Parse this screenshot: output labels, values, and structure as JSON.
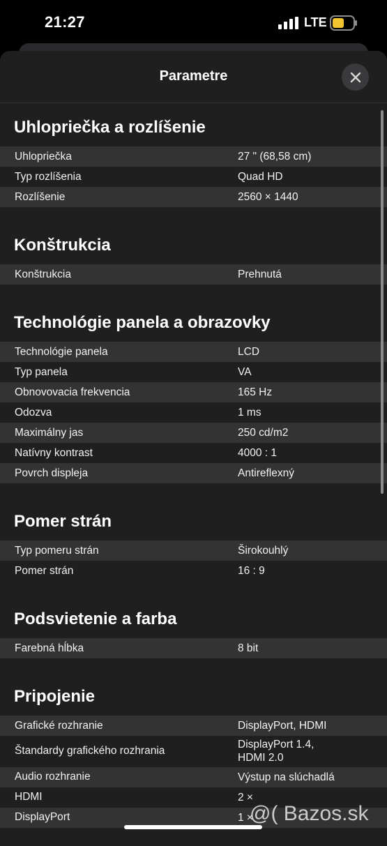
{
  "status_bar": {
    "time": "21:27",
    "network": "LTE"
  },
  "sheet": {
    "title": "Parametre"
  },
  "sections": [
    {
      "title": "Uhlopriečka a rozlíšenie",
      "rows": [
        {
          "label": "Uhlopriečka",
          "value": "27 \" (68,58 cm)"
        },
        {
          "label": "Typ rozlíšenia",
          "value": "Quad HD"
        },
        {
          "label": "Rozlíšenie",
          "value": "2560 × 1440"
        }
      ]
    },
    {
      "title": "Konštrukcia",
      "rows": [
        {
          "label": "Konštrukcia",
          "value": "Prehnutá"
        }
      ]
    },
    {
      "title": "Technológie panela a obrazovky",
      "rows": [
        {
          "label": "Technológie panela",
          "value": "LCD"
        },
        {
          "label": "Typ panela",
          "value": "VA"
        },
        {
          "label": "Obnovovacia frekvencia",
          "value": "165 Hz"
        },
        {
          "label": "Odozva",
          "value": "1 ms"
        },
        {
          "label": "Maximálny jas",
          "value": "250 cd/m2"
        },
        {
          "label": "Natívny kontrast",
          "value": "4000 : 1"
        },
        {
          "label": "Povrch displeja",
          "value": "Antireflexný"
        }
      ]
    },
    {
      "title": "Pomer strán",
      "rows": [
        {
          "label": "Typ pomeru strán",
          "value": "Širokouhlý"
        },
        {
          "label": "Pomer strán",
          "value": "16 : 9"
        }
      ]
    },
    {
      "title": "Podsvietenie a farba",
      "rows": [
        {
          "label": "Farebná hĺbka",
          "value": "8 bit"
        }
      ]
    },
    {
      "title": "Pripojenie",
      "rows": [
        {
          "label": "Grafické rozhranie",
          "value": "DisplayPort, HDMI"
        },
        {
          "label": "Štandardy grafického rozhrania",
          "value": "DisplayPort 1.4,\nHDMI 2.0"
        },
        {
          "label": "Audio rozhranie",
          "value": "Výstup na slúchadlá"
        },
        {
          "label": "HDMI",
          "value": "2 ×"
        },
        {
          "label": "DisplayPort",
          "value": "1 ×"
        }
      ]
    }
  ],
  "watermark": "@( Bazos.sk",
  "colors": {
    "battery": "#f4c430",
    "row_shade": "#333333",
    "sheet_bg": "#1f1f1f"
  },
  "icons": [
    "signal-icon",
    "battery-icon",
    "close-icon"
  ]
}
